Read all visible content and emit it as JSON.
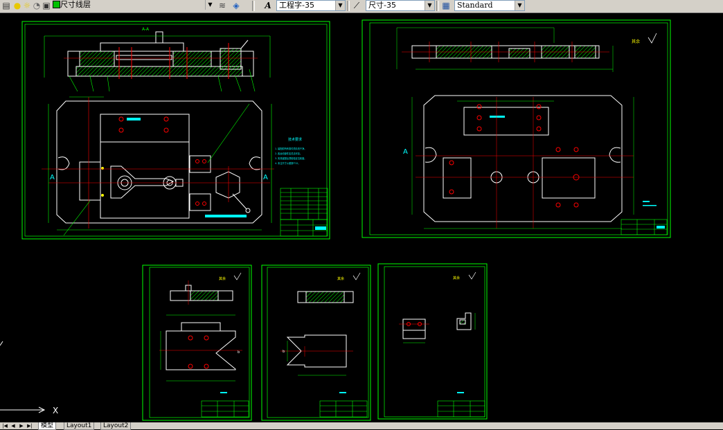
{
  "toolbar": {
    "layer_combo": {
      "value": "尺寸线层"
    },
    "text_style_combo": {
      "value": "工程字-35"
    },
    "dim_style_combo": {
      "value": "尺寸-35"
    },
    "table_style_combo": {
      "value": "Standard"
    }
  },
  "drawing": {
    "section_mark": "A-A",
    "view_label_a": "A",
    "view_label_a2": "A",
    "view_label_a3": "A",
    "roughness_note": "其余",
    "tech_req_title": "技术要求",
    "tech_req_lines": [
      "1. 装配前所有零件须清洗干净。",
      "2. 各运动部件应灵活可靠。",
      "3. 夹具装配后须检验定位精度。",
      "4. 未注尺寸公差按IT12。"
    ],
    "face_label_b": "b"
  },
  "ucs": {
    "x_label": "X"
  },
  "tabs": {
    "model": "模型",
    "layout1": "Layout1",
    "layout2": "Layout2"
  },
  "colors": {
    "background": "#000000",
    "frame": "#00ff00",
    "geometry": "#ffffff",
    "centerline": "#ff0000",
    "dimension": "#00ff00",
    "annotation": "#00ffff",
    "note": "#ffff00"
  }
}
